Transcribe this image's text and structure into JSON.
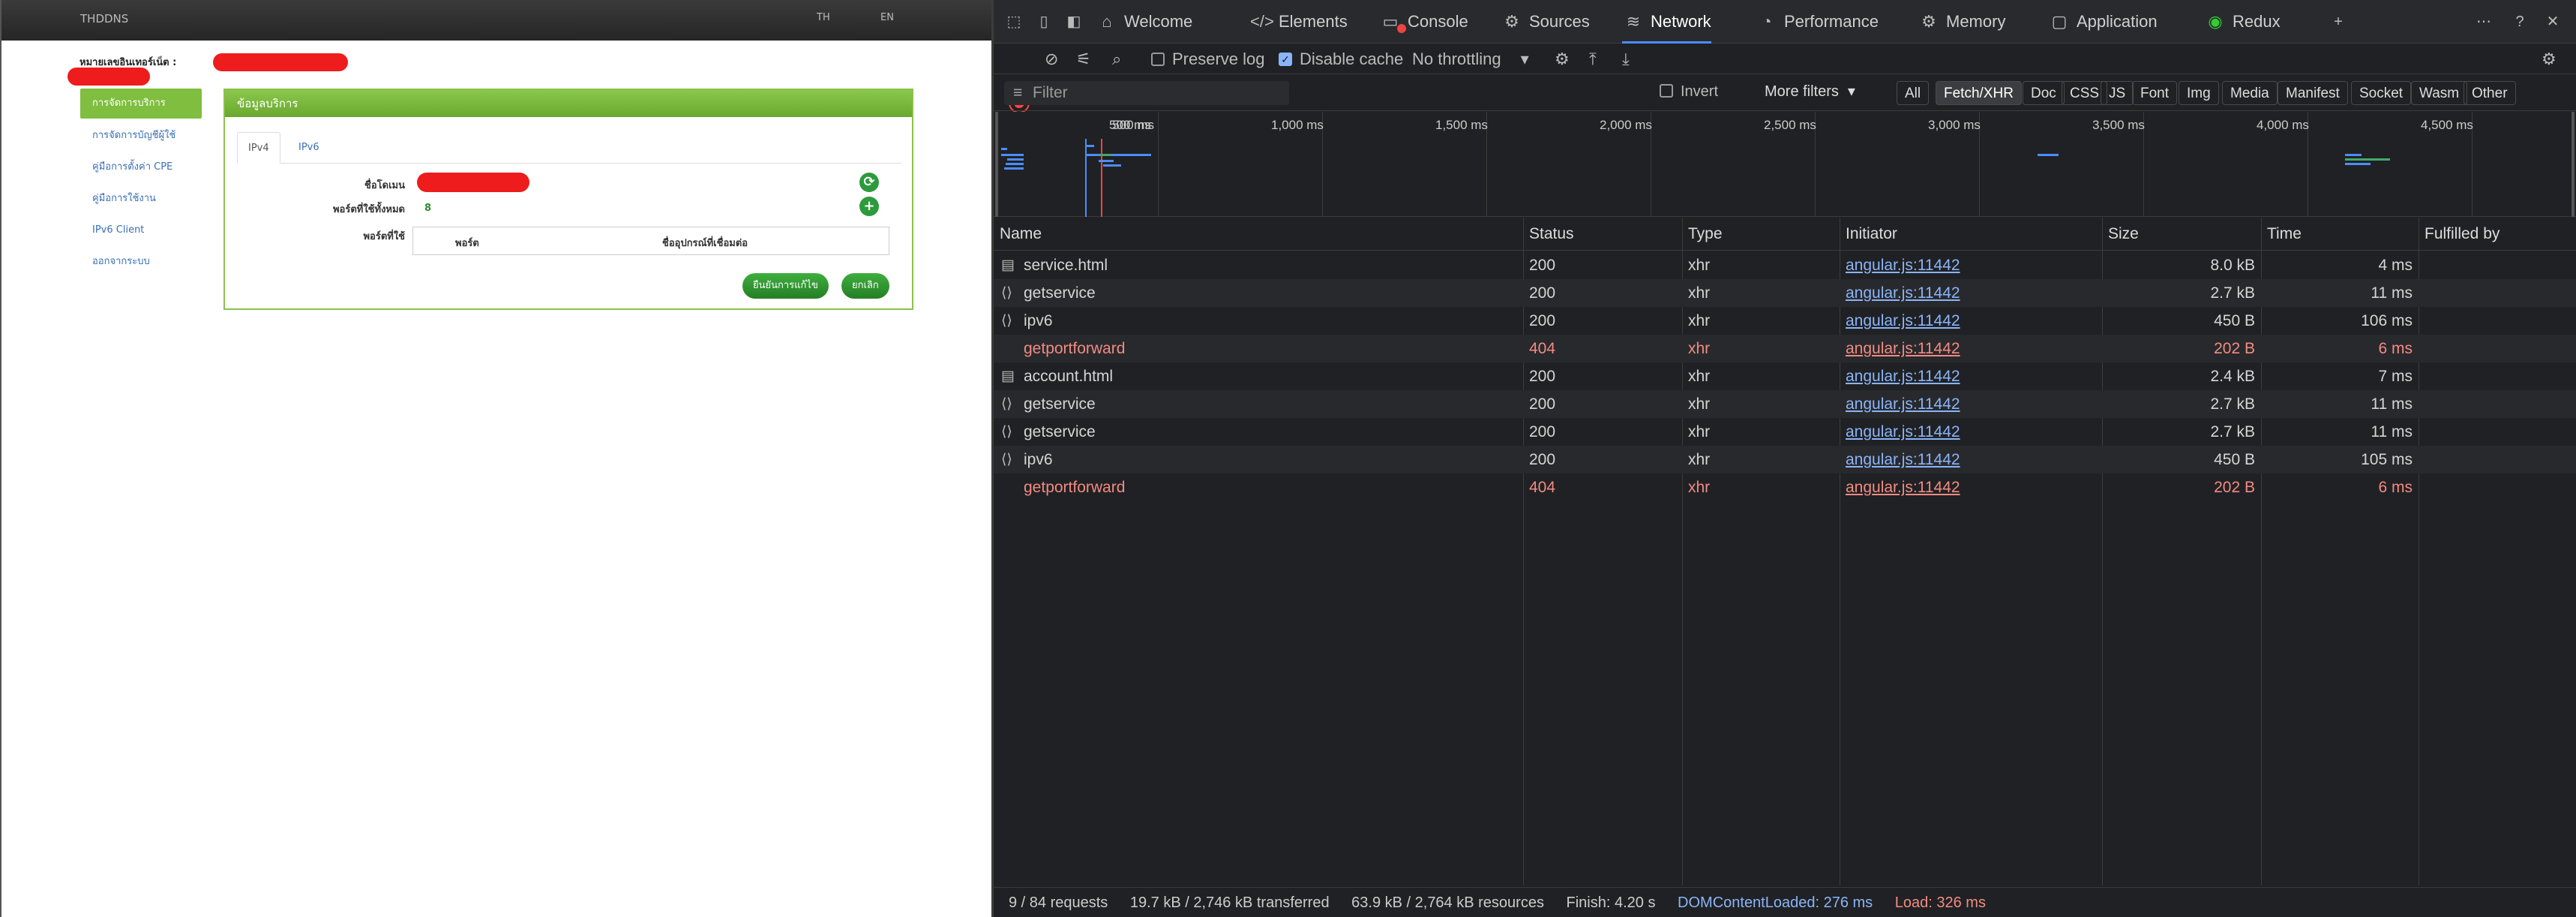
{
  "page": {
    "brand": "THDDNS",
    "lang_th": "TH",
    "lang_en": "EN",
    "account_label": "หมายเลขอินเทอร์เน็ต :",
    "menu": [
      {
        "label": "การจัดการบริการ",
        "active": true
      },
      {
        "label": "การจัดการบัญชีผู้ใช้",
        "active": false
      },
      {
        "label": "คู่มือการตั้งค่า CPE",
        "active": false
      },
      {
        "label": "คู่มือการใช้งาน",
        "active": false
      },
      {
        "label": "IPv6 Client",
        "active": false
      },
      {
        "label": "ออกจากระบบ",
        "active": false
      }
    ],
    "panel": {
      "title": "ข้อมูลบริการ",
      "tabs": [
        "IPv4",
        "IPv6"
      ],
      "domain_label": "ชื่อโดเมน",
      "ports_total_label": "พอร์ตที่ใช้ทั้งหมด",
      "ports_total_value": "8",
      "ports_used_label": "พอร์ตที่ใช้",
      "table_headers": [
        "พอร์ต",
        "ชื่ออุปกรณ์ที่เชื่อมต่อ"
      ],
      "confirm_label": "ยืนยันการแก้ไข",
      "cancel_label": "ยกเลิก",
      "refresh_icon": "⟳",
      "add_icon": "+"
    }
  },
  "devtools": {
    "tabs": [
      {
        "label": "Welcome",
        "icon": "⌂"
      },
      {
        "label": "Elements",
        "icon": "</>"
      },
      {
        "label": "Console",
        "icon": "▭"
      },
      {
        "label": "Sources",
        "icon": "⚙"
      },
      {
        "label": "Network",
        "icon": "≋"
      },
      {
        "label": "Performance",
        "icon": "◔"
      },
      {
        "label": "Memory",
        "icon": "⚙"
      },
      {
        "label": "Application",
        "icon": "▢"
      },
      {
        "label": "Redux",
        "icon": "◉"
      }
    ],
    "toolbar": {
      "preserve_log": "Preserve log",
      "disable_cache": "Disable cache",
      "throttling": "No throttling"
    },
    "filter": {
      "placeholder": "Filter",
      "invert": "Invert",
      "more_filters": "More filters",
      "types": [
        "All",
        "Fetch/XHR",
        "Doc",
        "CSS",
        "JS",
        "Font",
        "Img",
        "Media",
        "Manifest",
        "Socket",
        "Wasm",
        "Other"
      ],
      "active_type": "Fetch/XHR"
    },
    "timeline_ticks": [
      "500 ms",
      "1,000 ms",
      "1,500 ms",
      "2,000 ms",
      "2,500 ms",
      "3,000 ms",
      "3,500 ms",
      "4,000 ms",
      "4,500 ms"
    ],
    "columns": [
      "Name",
      "Status",
      "Type",
      "Initiator",
      "Size",
      "Time",
      "Fulfilled by"
    ],
    "rows": [
      {
        "icon": "doc",
        "name": "service.html",
        "status": "200",
        "type": "xhr",
        "initiator": "angular.js:11442",
        "size": "8.0 kB",
        "time": "4 ms",
        "error": false
      },
      {
        "icon": "fetch",
        "name": "getservice",
        "status": "200",
        "type": "xhr",
        "initiator": "angular.js:11442",
        "size": "2.7 kB",
        "time": "11 ms",
        "error": false
      },
      {
        "icon": "fetch",
        "name": "ipv6",
        "status": "200",
        "type": "xhr",
        "initiator": "angular.js:11442",
        "size": "450 B",
        "time": "106 ms",
        "error": false
      },
      {
        "icon": "",
        "name": "getportforward",
        "status": "404",
        "type": "xhr",
        "initiator": "angular.js:11442",
        "size": "202 B",
        "time": "6 ms",
        "error": true
      },
      {
        "icon": "doc",
        "name": "account.html",
        "status": "200",
        "type": "xhr",
        "initiator": "angular.js:11442",
        "size": "2.4 kB",
        "time": "7 ms",
        "error": false
      },
      {
        "icon": "fetch",
        "name": "getservice",
        "status": "200",
        "type": "xhr",
        "initiator": "angular.js:11442",
        "size": "2.7 kB",
        "time": "11 ms",
        "error": false
      },
      {
        "icon": "fetch",
        "name": "getservice",
        "status": "200",
        "type": "xhr",
        "initiator": "angular.js:11442",
        "size": "2.7 kB",
        "time": "11 ms",
        "error": false
      },
      {
        "icon": "fetch",
        "name": "ipv6",
        "status": "200",
        "type": "xhr",
        "initiator": "angular.js:11442",
        "size": "450 B",
        "time": "105 ms",
        "error": false
      },
      {
        "icon": "",
        "name": "getportforward",
        "status": "404",
        "type": "xhr",
        "initiator": "angular.js:11442",
        "size": "202 B",
        "time": "6 ms",
        "error": true
      }
    ],
    "status": {
      "requests": "9 / 84 requests",
      "transferred": "19.7 kB / 2,746 kB transferred",
      "resources": "63.9 kB / 2,764 kB resources",
      "finish": "Finish: 4.20 s",
      "dcl": "DOMContentLoaded: 276 ms",
      "load": "Load: 326 ms"
    }
  }
}
